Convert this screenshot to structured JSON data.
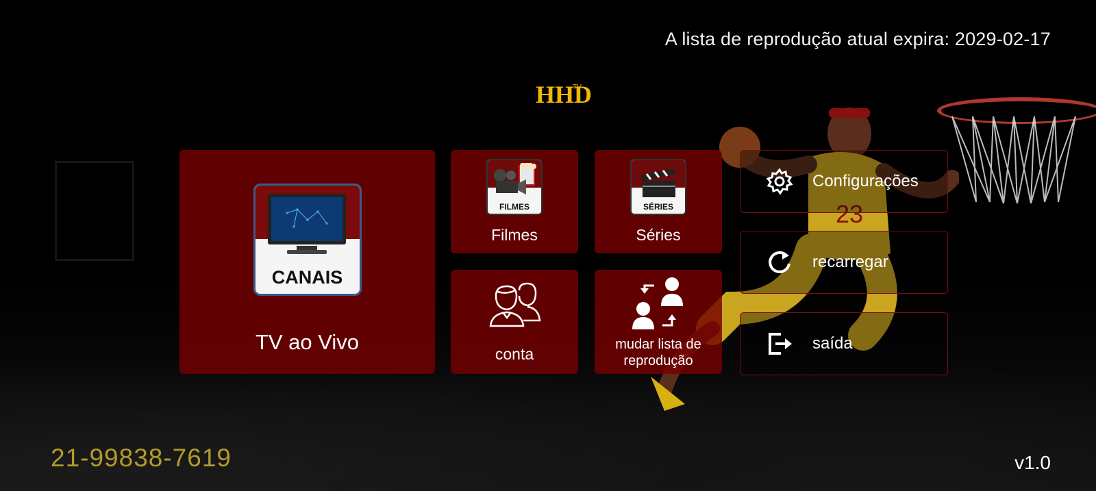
{
  "header": {
    "expiry_text": "A lista de reprodução atual expira: 2029-02-17",
    "logo_text": "HHD",
    "logo_sub": "TV"
  },
  "tiles": {
    "live": {
      "label": "TV ao Vivo",
      "icon_caption": "CANAIS",
      "icon": "tv-icon"
    },
    "movies": {
      "label": "Filmes",
      "icon_caption": "FILMES",
      "icon": "movie-camera-icon"
    },
    "series": {
      "label": "Séries",
      "icon_caption": "SÉRIES",
      "icon": "clapperboard-icon"
    },
    "account": {
      "label": "conta",
      "icon": "users-icon"
    },
    "playlist": {
      "label": "mudar lista de reprodução",
      "icon": "switch-users-icon"
    }
  },
  "side": {
    "settings": {
      "label": "Configurações",
      "icon": "gear-icon"
    },
    "reload": {
      "label": "recarregar",
      "icon": "reload-icon"
    },
    "exit": {
      "label": "saída",
      "icon": "exit-icon"
    }
  },
  "footer": {
    "phone": "21-99838-7619",
    "version": "v1.0"
  },
  "colors": {
    "tile_bg": "#760000",
    "logo_gold": "#f2b705",
    "phone_gold": "#b39a2a",
    "border_red": "#7a0e0e"
  }
}
